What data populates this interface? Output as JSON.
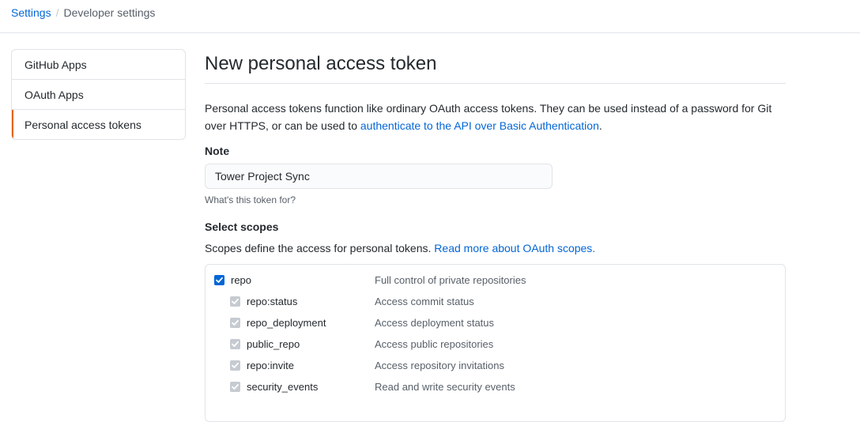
{
  "breadcrumb": {
    "root": "Settings",
    "separator": "/",
    "current": "Developer settings"
  },
  "sidenav": {
    "items": [
      {
        "label": "GitHub Apps"
      },
      {
        "label": "OAuth Apps"
      },
      {
        "label": "Personal access tokens"
      }
    ]
  },
  "main": {
    "title": "New personal access token",
    "intro_text": "Personal access tokens function like ordinary OAuth access tokens. They can be used instead of a password for Git over HTTPS, or can be used to ",
    "intro_link": "authenticate to the API over Basic Authentication",
    "intro_end": ".",
    "note_label": "Note",
    "note_value": "Tower Project Sync",
    "note_hint": "What's this token for?",
    "scopes_label": "Select scopes",
    "scopes_desc": "Scopes define the access for personal tokens.",
    "scopes_link": "Read more about OAuth scopes."
  },
  "scopes": [
    {
      "name": "repo",
      "desc": "Full control of private repositories",
      "checked": true,
      "child": false
    },
    {
      "name": "repo:status",
      "desc": "Access commit status",
      "checked": true,
      "child": true
    },
    {
      "name": "repo_deployment",
      "desc": "Access deployment status",
      "checked": true,
      "child": true
    },
    {
      "name": "public_repo",
      "desc": "Access public repositories",
      "checked": true,
      "child": true
    },
    {
      "name": "repo:invite",
      "desc": "Access repository invitations",
      "checked": true,
      "child": true
    },
    {
      "name": "security_events",
      "desc": "Read and write security events",
      "checked": true,
      "child": true
    }
  ],
  "colors": {
    "link": "#0366d6",
    "selected_accent": "#e36209",
    "checkbox": "#0366d6",
    "checkbox_disabled": "#c6cbd1"
  }
}
